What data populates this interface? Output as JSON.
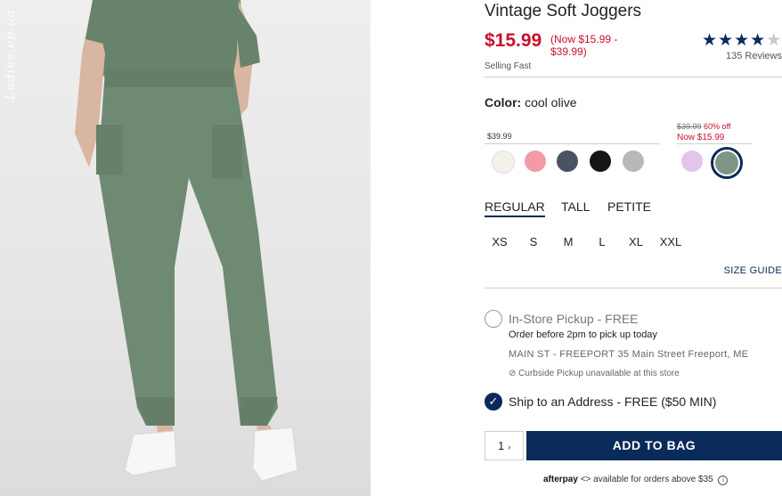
{
  "product": {
    "title": "Vintage Soft Joggers",
    "price": "$15.99",
    "price_range": "(Now $15.99 - $39.99)",
    "selling_fast": "Selling Fast",
    "rating": 4.5,
    "reviews": "135 Reviews",
    "image_watermark": "Ladies.ep.ua"
  },
  "color": {
    "label": "Color:",
    "value": "cool olive",
    "group1_price": "$39.99",
    "sale_original": "$39.99",
    "sale_pct": "60% off",
    "sale_now": "Now $15.99",
    "swatches": [
      {
        "name": "ivory",
        "hex": "#f4f1ea"
      },
      {
        "name": "pink",
        "hex": "#f29aa5"
      },
      {
        "name": "navy-gray",
        "hex": "#4b5363"
      },
      {
        "name": "black",
        "hex": "#151515"
      },
      {
        "name": "heather-gray",
        "hex": "#b8b8b8"
      },
      {
        "name": "lavender",
        "hex": "#e2c5ea"
      },
      {
        "name": "cool-olive",
        "hex": "#7f9584",
        "selected": true
      }
    ]
  },
  "fit_tabs": [
    "REGULAR",
    "TALL",
    "PETITE"
  ],
  "sizes": [
    "XS",
    "S",
    "M",
    "L",
    "XL",
    "XXL"
  ],
  "size_guide": "SIZE GUIDE",
  "pickup": {
    "instore_label": "In-Store Pickup - FREE",
    "order_before": "Order before 2pm to pick up today",
    "store_address": "MAIN ST - FREEPORT 35 Main Street Freeport, ME",
    "curbside": "Curbside Pickup unavailable at this store",
    "ship_label": "Ship to an Address - FREE ($50 MIN)"
  },
  "cart": {
    "quantity": "1",
    "add_to_bag": "ADD TO BAG"
  },
  "afterpay": {
    "logo": "afterpay",
    "text": "available for orders above $35"
  },
  "colors": {
    "brand_navy": "#0a2a5a",
    "sale_red": "#c8102e",
    "pants_olive": "#6f8a73"
  }
}
